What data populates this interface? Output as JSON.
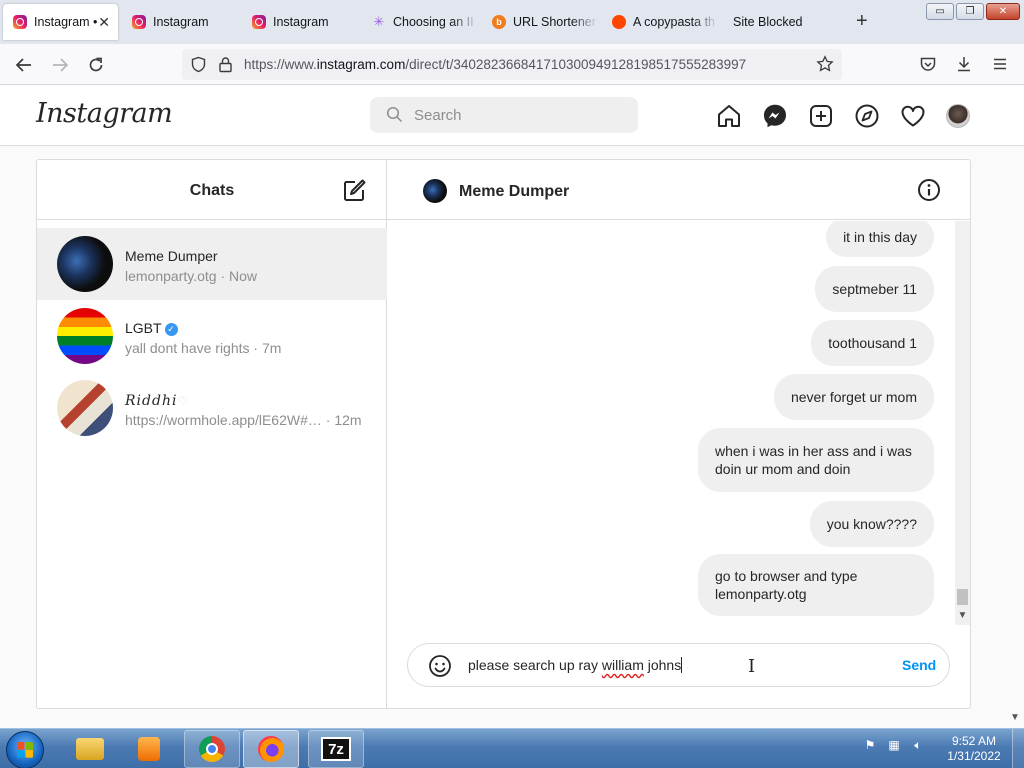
{
  "browser": {
    "tabs": [
      {
        "label": "Instagram •",
        "icon": "instagram-icon",
        "active": true
      },
      {
        "label": "Instagram",
        "icon": "instagram-icon"
      },
      {
        "label": "Instagram",
        "icon": "instagram-icon"
      },
      {
        "label": "Choosing an II",
        "icon": "sparkle-icon"
      },
      {
        "label": "URL Shortener",
        "icon": "bitly-icon"
      },
      {
        "label": "A copypasta th",
        "icon": "reddit-icon"
      },
      {
        "label": "Site Blocked",
        "icon": ""
      }
    ],
    "new_tab": "+",
    "url_prefix": "https://www.",
    "url_domain": "instagram.com",
    "url_path": "/direct/t/340282366841710300949128198517555283997",
    "window_controls": {
      "minimize": "▭",
      "restore": "❐",
      "close": "✕"
    }
  },
  "instagram": {
    "logo": "Instagram",
    "search_placeholder": "Search",
    "nav_icons": [
      "home-icon",
      "messenger-icon",
      "new-post-icon",
      "explore-icon",
      "activity-heart-icon",
      "profile-avatar"
    ]
  },
  "inbox": {
    "title": "Chats",
    "threads": [
      {
        "name": "Meme Dumper",
        "preview": "lemonparty.otg",
        "time": " · Now",
        "selected": true
      },
      {
        "name": "LGBT",
        "preview": "yall dont have rights",
        "time": " · 7m",
        "verified": true
      },
      {
        "name": "𝑅𝑖𝑑𝑑ℎ𝑖",
        "preview": "https://wormhole.app/lE62W#…",
        "time": " · 12m",
        "heart": "♡"
      }
    ]
  },
  "conversation": {
    "name": "Meme Dumper",
    "messages": [
      "it in this day",
      "septmeber 11",
      "toothousand 1",
      "never forget ur mom",
      "when i was in her ass and i was doin ur mom and doin",
      "you know????",
      "go to browser and type lemonparty.otg"
    ],
    "draft_before": "please search up ray ",
    "draft_misspelled": "william",
    "draft_after": " johns",
    "send_label": "Send"
  },
  "taskbar": {
    "apps": [
      "windows-explorer",
      "media-player",
      "chrome",
      "firefox",
      "7-zip"
    ],
    "time": "9:52 AM",
    "date": "1/31/2022"
  },
  "colors": {
    "accent": "#0095f6",
    "bubble": "#efefef",
    "selected_thread": "#efefef",
    "verified": "#3897f0"
  }
}
